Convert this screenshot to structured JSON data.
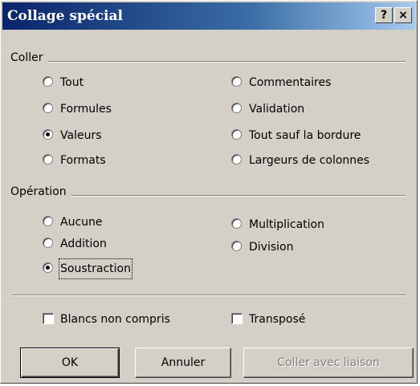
{
  "window": {
    "title": "Collage spécial",
    "help_label": "?",
    "close_label": "×"
  },
  "paste_group": {
    "label": "Coller",
    "options": [
      {
        "label": "Tout",
        "checked": false
      },
      {
        "label": "Formules",
        "checked": false
      },
      {
        "label": "Valeurs",
        "checked": true
      },
      {
        "label": "Formats",
        "checked": false
      },
      {
        "label": "Commentaires",
        "checked": false
      },
      {
        "label": "Validation",
        "checked": false
      },
      {
        "label": "Tout sauf la bordure",
        "checked": false
      },
      {
        "label": "Largeurs de colonnes",
        "checked": false
      }
    ]
  },
  "operation_group": {
    "label": "Opération",
    "options": [
      {
        "label": "Aucune",
        "checked": false
      },
      {
        "label": "Addition",
        "checked": false
      },
      {
        "label": "Soustraction",
        "checked": true
      },
      {
        "label": "Multiplication",
        "checked": false
      },
      {
        "label": "Division",
        "checked": false
      }
    ]
  },
  "checkboxes": {
    "skip_blanks": {
      "label": "Blancs non compris",
      "checked": false
    },
    "transpose": {
      "label": "Transposé",
      "checked": false
    }
  },
  "buttons": {
    "ok": "OK",
    "cancel": "Annuler",
    "paste_link": "Coller avec liaison"
  }
}
